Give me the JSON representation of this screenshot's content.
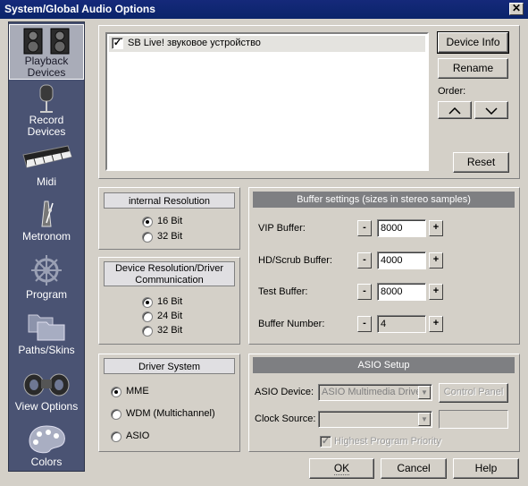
{
  "window": {
    "title": "System/Global Audio Options",
    "close_glyph": "✕"
  },
  "sidebar": {
    "items": [
      {
        "label": "Playback Devices",
        "icon": "speakers-icon",
        "selected": true
      },
      {
        "label": "Record Devices",
        "icon": "microphone-icon",
        "selected": false
      },
      {
        "label": "Midi",
        "icon": "keyboard-icon",
        "selected": false
      },
      {
        "label": "Metronom",
        "icon": "metronome-icon",
        "selected": false
      },
      {
        "label": "Program",
        "icon": "ship-wheel-icon",
        "selected": false
      },
      {
        "label": "Paths/Skins",
        "icon": "folders-icon",
        "selected": false
      },
      {
        "label": "View Options",
        "icon": "binoculars-icon",
        "selected": false
      },
      {
        "label": "Colors",
        "icon": "palette-icon",
        "selected": false
      }
    ]
  },
  "devices": {
    "list": [
      {
        "label": "SB Live! звуковое устройство",
        "checked": true
      }
    ],
    "device_info": "Device Info",
    "rename": "Rename",
    "order_label": "Order:",
    "reset": "Reset"
  },
  "internal_resolution": {
    "title": "internal Resolution",
    "options": [
      "16 Bit",
      "32 Bit"
    ],
    "selected": "16 Bit"
  },
  "device_resolution": {
    "title_line1": "Device Resolution/Driver",
    "title_line2": "Communication",
    "options": [
      "16 Bit",
      "24 Bit",
      "32 Bit"
    ],
    "selected": "16 Bit"
  },
  "driver_system": {
    "title": "Driver System",
    "options": [
      "MME",
      "WDM (Multichannel)",
      "ASIO"
    ],
    "selected": "MME"
  },
  "buffer": {
    "title": "Buffer settings (sizes in stereo samples)",
    "minus": "-",
    "plus": "+",
    "rows": [
      {
        "label": "VIP Buffer:",
        "value": "8000",
        "enabled": true
      },
      {
        "label": "HD/Scrub Buffer:",
        "value": "4000",
        "enabled": true
      },
      {
        "label": "Test Buffer:",
        "value": "8000",
        "enabled": true
      },
      {
        "label": "Buffer Number:",
        "value": "4",
        "enabled": false
      }
    ]
  },
  "asio": {
    "title": "ASIO Setup",
    "device_label": "ASIO Device:",
    "device_value": "ASIO Multimedia Driver",
    "control_panel": "Control Panel",
    "clock_label": "Clock Source:",
    "clock_value": "",
    "priority_label": "Highest Program Priority",
    "priority_checked": true
  },
  "footer": {
    "ok": "OK",
    "cancel": "Cancel",
    "help": "Help"
  }
}
